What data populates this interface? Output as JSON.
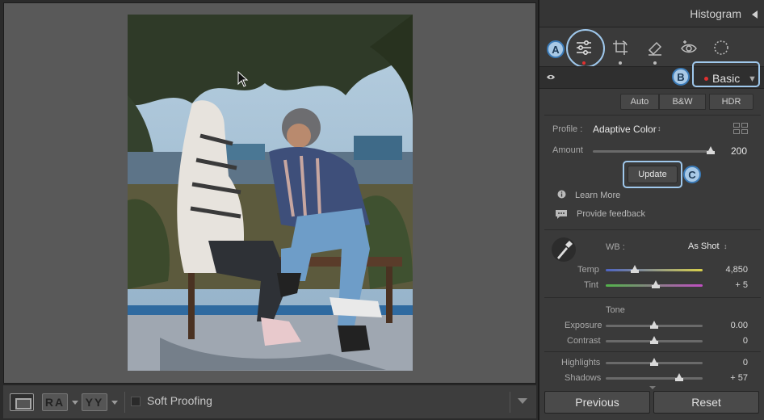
{
  "panel": {
    "histogram_title": "Histogram",
    "section_title": "Basic",
    "auto_label": "Auto",
    "bw_label": "B&W",
    "hdr_label": "HDR",
    "profile_label": "Profile :",
    "profile_value": "Adaptive Color",
    "profile_caret": "↕",
    "amount_label": "Amount",
    "amount_value": "200",
    "update_label": "Update",
    "learn_more": "Learn More",
    "provide_feedback": "Provide feedback",
    "wb_label": "WB :",
    "wb_value": "As Shot",
    "temp_label": "Temp",
    "temp_value": "4,850",
    "tint_label": "Tint",
    "tint_value": "+ 5",
    "tone_label": "Tone",
    "exposure_label": "Exposure",
    "exposure_value": "0.00",
    "contrast_label": "Contrast",
    "contrast_value": "0",
    "highlights_label": "Highlights",
    "highlights_value": "0",
    "shadows_label": "Shadows",
    "shadows_value": "+ 57",
    "previous_label": "Previous",
    "reset_label": "Reset"
  },
  "callouts": {
    "a": "A",
    "b": "B",
    "c": "C"
  },
  "toolbar": {
    "ab_label_1": "RA",
    "ab_label_2": "YY",
    "soft_proofing": "Soft Proofing"
  },
  "sliders": {
    "amount": 0.97,
    "temp": 0.3,
    "tint": 0.52,
    "exposure": 0.5,
    "contrast": 0.5,
    "highlights": 0.5,
    "shadows": 0.76
  },
  "colors": {
    "accent_callout": "#a8c9e6",
    "active_dot": "#e03030"
  },
  "icons": [
    "edit-sliders-icon",
    "crop-icon",
    "healing-eraser-icon",
    "redeye-icon",
    "masking-icon",
    "eye-icon",
    "eyedropper-icon",
    "info-icon",
    "feedback-icon",
    "grid-icon"
  ]
}
